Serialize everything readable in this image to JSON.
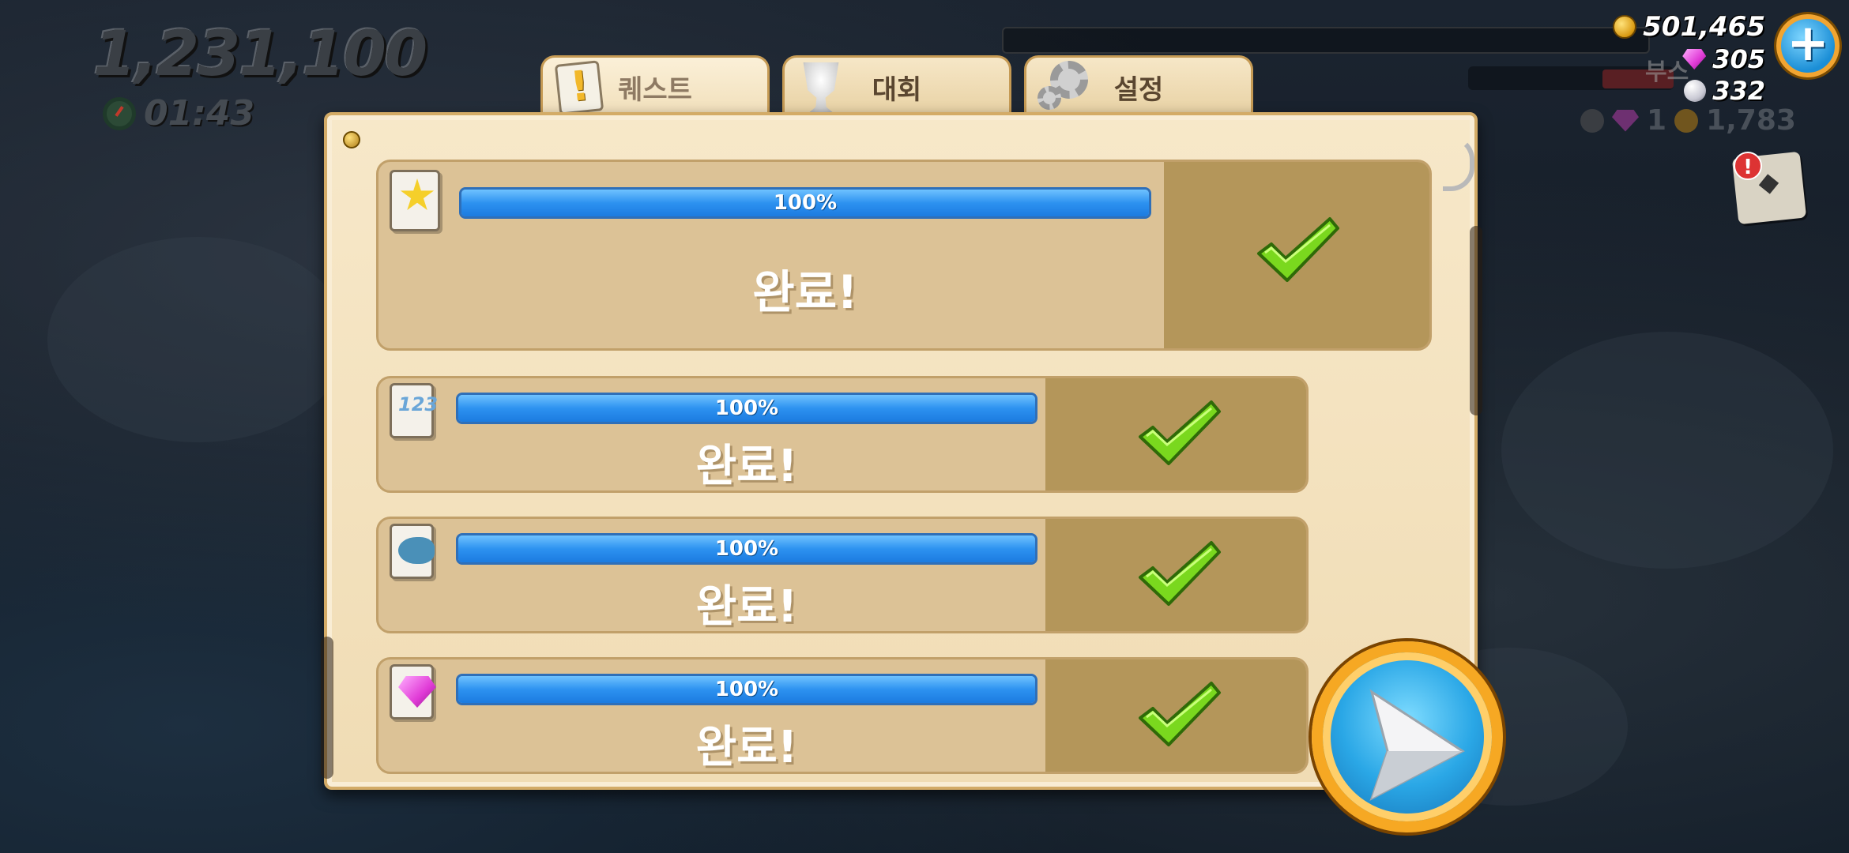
{
  "hud": {
    "score": "1,231,100",
    "timer": "01:43",
    "coins": "501,465",
    "gems": "305",
    "pearls": "332",
    "boost_label": "부스",
    "pickup_gems": "1",
    "pickup_coins": "1,783"
  },
  "tabs": [
    {
      "label": "퀘스트",
      "icon": "quest-scroll-icon",
      "active": true
    },
    {
      "label": "대회",
      "icon": "trophy-icon",
      "active": false
    },
    {
      "label": "설정",
      "icon": "gear-icon",
      "active": false
    }
  ],
  "quests": [
    {
      "icon": "star-quest-icon",
      "progress_label": "100%",
      "progress": 1.0,
      "status": "완료!",
      "completed": true
    },
    {
      "icon": "numbers-quest-icon",
      "icon_text": "123",
      "progress_label": "100%",
      "progress": 1.0,
      "status": "완료!",
      "completed": true
    },
    {
      "icon": "shark-quest-icon",
      "progress_label": "100%",
      "progress": 1.0,
      "status": "완료!",
      "completed": true
    },
    {
      "icon": "gems-quest-icon",
      "progress_label": "100%",
      "progress": 1.0,
      "status": "완료!",
      "completed": true
    }
  ],
  "colors": {
    "panel": "#f0dcb4",
    "row": "#dcc296",
    "check_area": "#b4965a",
    "progress": "#2d92f0",
    "check": "#7ad81e",
    "play_ring": "#f6a823"
  }
}
